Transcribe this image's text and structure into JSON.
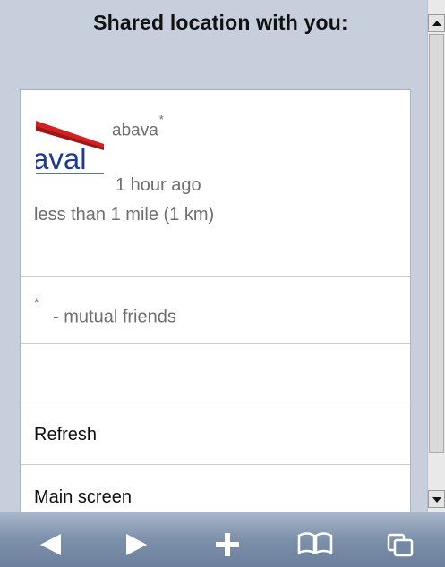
{
  "header": {
    "title": "Shared location with you:"
  },
  "friend": {
    "name": "abava",
    "mutual_marker": "*",
    "time_ago": "1 hour ago",
    "distance": "less than 1 mile (1 km)",
    "logo_text": "aval"
  },
  "legend": {
    "marker": "*",
    "text": " - mutual friends"
  },
  "actions": {
    "refresh_label": "Refresh",
    "main_screen_label": "Main screen"
  },
  "toolbar": {
    "buttons": [
      {
        "icon": "back-arrow-icon"
      },
      {
        "icon": "forward-arrow-icon"
      },
      {
        "icon": "add-plus-icon"
      },
      {
        "icon": "bookmarks-book-icon"
      },
      {
        "icon": "pages-icon"
      }
    ]
  },
  "colors": {
    "background": "#c6cfdb",
    "toolbar": "#7d90aa",
    "logo_red": "#d32020",
    "logo_blue": "#1f3a93"
  }
}
